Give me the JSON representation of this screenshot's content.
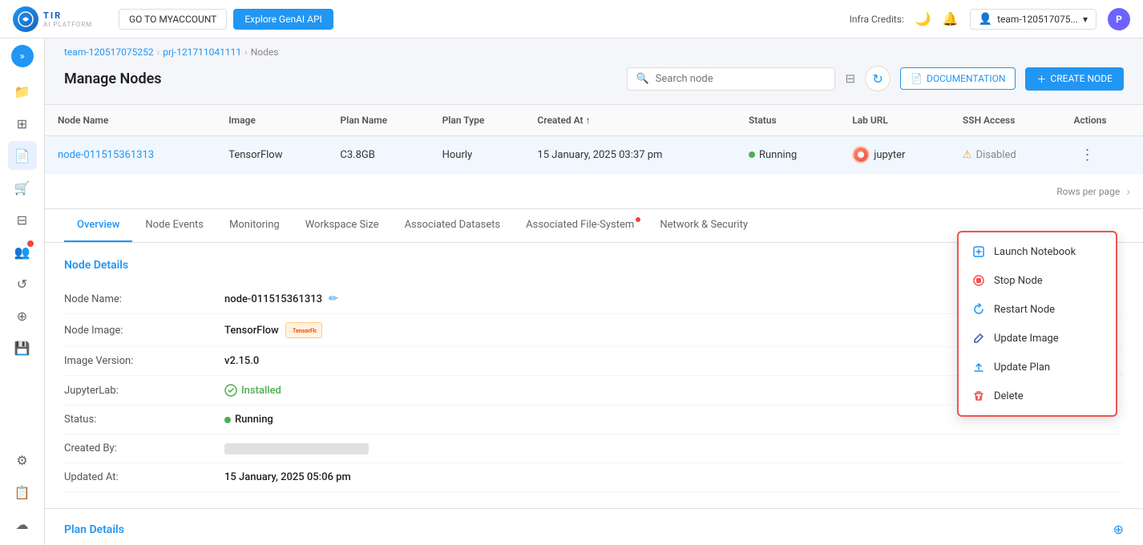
{
  "header": {
    "logo_text": "TIR",
    "logo_sub": "AI PLATFORM",
    "btn_go_my_account": "GO TO MYACCOUNT",
    "btn_explore": "Explore GenAI API",
    "infra_credits_label": "Infra Credits:",
    "team_name": "team-120517075...",
    "user_initial": "P"
  },
  "breadcrumb": {
    "team": "team-120517075252",
    "project": "prj-121711041111",
    "current": "Nodes"
  },
  "page": {
    "title": "Manage Nodes",
    "search_placeholder": "Search node",
    "btn_documentation": "DOCUMENTATION",
    "btn_create_node": "CREATE NODE"
  },
  "table": {
    "columns": [
      "Node Name",
      "Image",
      "Plan Name",
      "Plan Type",
      "Created At",
      "Status",
      "Lab URL",
      "SSH Access",
      "Actions"
    ],
    "rows": [
      {
        "node_name": "node-011515361313",
        "image": "TensorFlow",
        "plan_name": "C3.8GB",
        "plan_type": "Hourly",
        "created_at": "15 January, 2025 03:37 pm",
        "status": "Running",
        "lab_url": "jupyter",
        "ssh_access": "Disabled"
      }
    ],
    "rows_per_page_label": "Rows per page"
  },
  "context_menu": {
    "launch_notebook": "Launch Notebook",
    "stop_node": "Stop Node",
    "restart_node": "Restart Node",
    "update_image": "Update Image",
    "update_plan": "Update Plan",
    "delete": "Delete"
  },
  "tabs": [
    {
      "label": "Overview",
      "active": true,
      "dot": false
    },
    {
      "label": "Node Events",
      "active": false,
      "dot": false
    },
    {
      "label": "Monitoring",
      "active": false,
      "dot": false
    },
    {
      "label": "Workspace Size",
      "active": false,
      "dot": false
    },
    {
      "label": "Associated Datasets",
      "active": false,
      "dot": false
    },
    {
      "label": "Associated File-System",
      "active": false,
      "dot": true
    },
    {
      "label": "Network & Security",
      "active": false,
      "dot": false
    }
  ],
  "node_details": {
    "section_title": "Node Details",
    "node_name_label": "Node Name:",
    "node_name_value": "node-011515361313",
    "node_image_label": "Node Image:",
    "node_image_value": "TensorFlow",
    "image_version_label": "Image Version:",
    "image_version_value": "v2.15.0",
    "jupyterlab_label": "JupyterLab:",
    "jupyterlab_value": "Installed",
    "status_label": "Status:",
    "status_value": "Running",
    "created_by_label": "Created By:",
    "updated_at_label": "Updated At:",
    "updated_at_value": "15 January, 2025 05:06 pm"
  },
  "plan_details": {
    "section_title": "Plan Details"
  },
  "sidebar": {
    "items": [
      {
        "icon": "📁",
        "name": "files"
      },
      {
        "icon": "⊞",
        "name": "dashboard"
      },
      {
        "icon": "📄",
        "name": "nodes",
        "active": true
      },
      {
        "icon": "🛒",
        "name": "marketplace"
      },
      {
        "icon": "⊟",
        "name": "datasets"
      },
      {
        "icon": "👥",
        "name": "team",
        "badge": true
      },
      {
        "icon": "↺",
        "name": "jobs"
      },
      {
        "icon": "⊕",
        "name": "integrations"
      },
      {
        "icon": "💾",
        "name": "storage"
      },
      {
        "icon": "🔧",
        "name": "settings-bottom"
      },
      {
        "icon": "☁",
        "name": "cloud"
      }
    ]
  }
}
